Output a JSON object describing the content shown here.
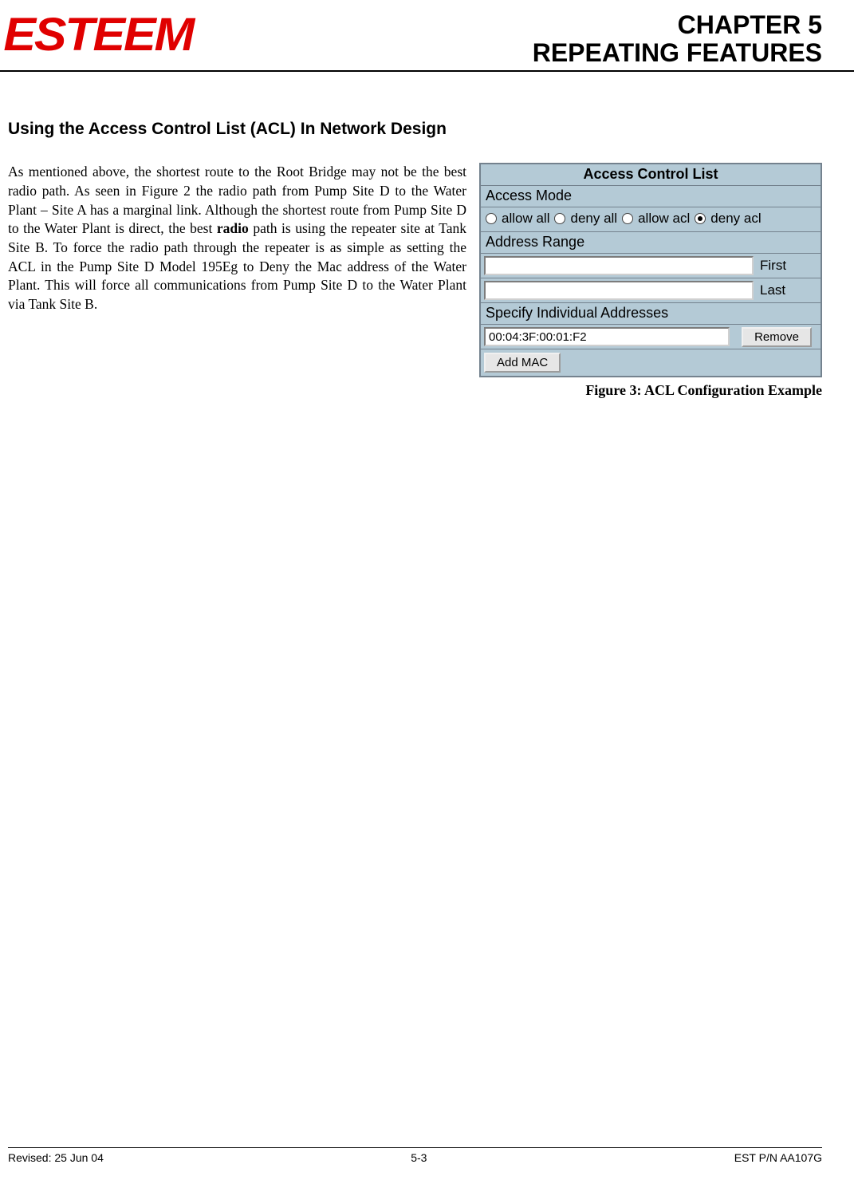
{
  "header": {
    "logo_text": "ESTEEM",
    "chapter_line1": "CHAPTER 5",
    "chapter_line2": "REPEATING FEATURES"
  },
  "section": {
    "heading": "Using the Access Control List (ACL) In Network Design",
    "para_a": "As mentioned above, the shortest route to the Root Bridge may not be the best radio path.  As seen in Figure 2 the radio path from Pump Site D to the Water Plant – Site A has a marginal link.  Although the shortest route from Pump Site D to the Water Plant is direct, the best ",
    "para_bold": "radio",
    "para_b": " path is using the repeater site at Tank Site B.  To force the radio path through the repeater is as simple as setting the ACL in the Pump Site D Model 195Eg to Deny the Mac address of the Water Plant.  This will force all communications from Pump Site D to the Water Plant via Tank Site B."
  },
  "acl": {
    "title": "Access Control List",
    "access_mode_label": "Access Mode",
    "options": {
      "allow_all": "allow all",
      "deny_all": "deny all",
      "allow_acl": "allow acl",
      "deny_acl": "deny acl"
    },
    "address_range_label": "Address Range",
    "first_label": "First",
    "last_label": "Last",
    "specify_label": "Specify Individual Addresses",
    "mac_value": "00:04:3F:00:01:F2",
    "remove_btn": "Remove",
    "add_btn": "Add MAC"
  },
  "figure_caption": "Figure 3: ACL Configuration Example",
  "footer": {
    "revised": "Revised: 25 Jun 04",
    "page": "5-3",
    "pn": "EST P/N AA107G"
  }
}
